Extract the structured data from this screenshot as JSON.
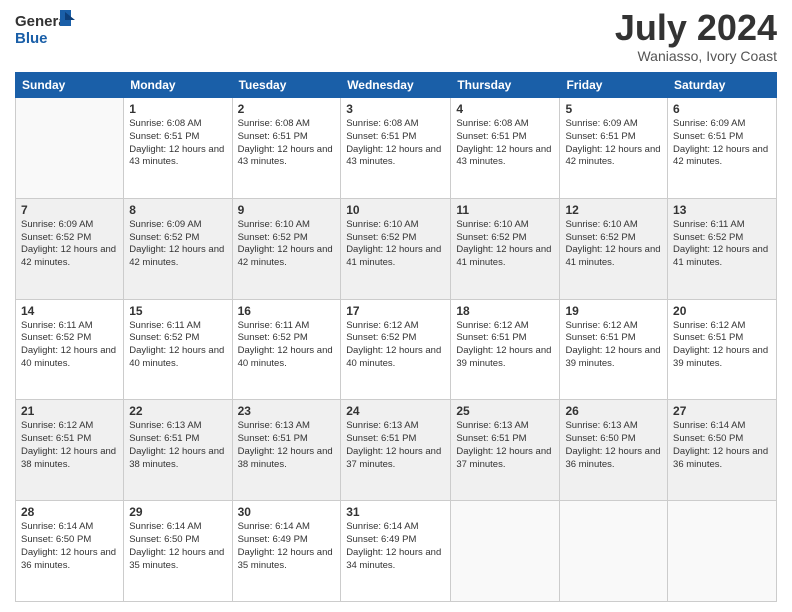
{
  "header": {
    "logo_line1": "General",
    "logo_line2": "Blue",
    "month_title": "July 2024",
    "location": "Waniasso, Ivory Coast"
  },
  "days_of_week": [
    "Sunday",
    "Monday",
    "Tuesday",
    "Wednesday",
    "Thursday",
    "Friday",
    "Saturday"
  ],
  "weeks": [
    [
      {
        "day": "",
        "sunrise": "",
        "sunset": "",
        "daylight": ""
      },
      {
        "day": "1",
        "sunrise": "Sunrise: 6:08 AM",
        "sunset": "Sunset: 6:51 PM",
        "daylight": "Daylight: 12 hours and 43 minutes."
      },
      {
        "day": "2",
        "sunrise": "Sunrise: 6:08 AM",
        "sunset": "Sunset: 6:51 PM",
        "daylight": "Daylight: 12 hours and 43 minutes."
      },
      {
        "day": "3",
        "sunrise": "Sunrise: 6:08 AM",
        "sunset": "Sunset: 6:51 PM",
        "daylight": "Daylight: 12 hours and 43 minutes."
      },
      {
        "day": "4",
        "sunrise": "Sunrise: 6:08 AM",
        "sunset": "Sunset: 6:51 PM",
        "daylight": "Daylight: 12 hours and 43 minutes."
      },
      {
        "day": "5",
        "sunrise": "Sunrise: 6:09 AM",
        "sunset": "Sunset: 6:51 PM",
        "daylight": "Daylight: 12 hours and 42 minutes."
      },
      {
        "day": "6",
        "sunrise": "Sunrise: 6:09 AM",
        "sunset": "Sunset: 6:51 PM",
        "daylight": "Daylight: 12 hours and 42 minutes."
      }
    ],
    [
      {
        "day": "7",
        "sunrise": "Sunrise: 6:09 AM",
        "sunset": "Sunset: 6:52 PM",
        "daylight": "Daylight: 12 hours and 42 minutes."
      },
      {
        "day": "8",
        "sunrise": "Sunrise: 6:09 AM",
        "sunset": "Sunset: 6:52 PM",
        "daylight": "Daylight: 12 hours and 42 minutes."
      },
      {
        "day": "9",
        "sunrise": "Sunrise: 6:10 AM",
        "sunset": "Sunset: 6:52 PM",
        "daylight": "Daylight: 12 hours and 42 minutes."
      },
      {
        "day": "10",
        "sunrise": "Sunrise: 6:10 AM",
        "sunset": "Sunset: 6:52 PM",
        "daylight": "Daylight: 12 hours and 41 minutes."
      },
      {
        "day": "11",
        "sunrise": "Sunrise: 6:10 AM",
        "sunset": "Sunset: 6:52 PM",
        "daylight": "Daylight: 12 hours and 41 minutes."
      },
      {
        "day": "12",
        "sunrise": "Sunrise: 6:10 AM",
        "sunset": "Sunset: 6:52 PM",
        "daylight": "Daylight: 12 hours and 41 minutes."
      },
      {
        "day": "13",
        "sunrise": "Sunrise: 6:11 AM",
        "sunset": "Sunset: 6:52 PM",
        "daylight": "Daylight: 12 hours and 41 minutes."
      }
    ],
    [
      {
        "day": "14",
        "sunrise": "Sunrise: 6:11 AM",
        "sunset": "Sunset: 6:52 PM",
        "daylight": "Daylight: 12 hours and 40 minutes."
      },
      {
        "day": "15",
        "sunrise": "Sunrise: 6:11 AM",
        "sunset": "Sunset: 6:52 PM",
        "daylight": "Daylight: 12 hours and 40 minutes."
      },
      {
        "day": "16",
        "sunrise": "Sunrise: 6:11 AM",
        "sunset": "Sunset: 6:52 PM",
        "daylight": "Daylight: 12 hours and 40 minutes."
      },
      {
        "day": "17",
        "sunrise": "Sunrise: 6:12 AM",
        "sunset": "Sunset: 6:52 PM",
        "daylight": "Daylight: 12 hours and 40 minutes."
      },
      {
        "day": "18",
        "sunrise": "Sunrise: 6:12 AM",
        "sunset": "Sunset: 6:51 PM",
        "daylight": "Daylight: 12 hours and 39 minutes."
      },
      {
        "day": "19",
        "sunrise": "Sunrise: 6:12 AM",
        "sunset": "Sunset: 6:51 PM",
        "daylight": "Daylight: 12 hours and 39 minutes."
      },
      {
        "day": "20",
        "sunrise": "Sunrise: 6:12 AM",
        "sunset": "Sunset: 6:51 PM",
        "daylight": "Daylight: 12 hours and 39 minutes."
      }
    ],
    [
      {
        "day": "21",
        "sunrise": "Sunrise: 6:12 AM",
        "sunset": "Sunset: 6:51 PM",
        "daylight": "Daylight: 12 hours and 38 minutes."
      },
      {
        "day": "22",
        "sunrise": "Sunrise: 6:13 AM",
        "sunset": "Sunset: 6:51 PM",
        "daylight": "Daylight: 12 hours and 38 minutes."
      },
      {
        "day": "23",
        "sunrise": "Sunrise: 6:13 AM",
        "sunset": "Sunset: 6:51 PM",
        "daylight": "Daylight: 12 hours and 38 minutes."
      },
      {
        "day": "24",
        "sunrise": "Sunrise: 6:13 AM",
        "sunset": "Sunset: 6:51 PM",
        "daylight": "Daylight: 12 hours and 37 minutes."
      },
      {
        "day": "25",
        "sunrise": "Sunrise: 6:13 AM",
        "sunset": "Sunset: 6:51 PM",
        "daylight": "Daylight: 12 hours and 37 minutes."
      },
      {
        "day": "26",
        "sunrise": "Sunrise: 6:13 AM",
        "sunset": "Sunset: 6:50 PM",
        "daylight": "Daylight: 12 hours and 36 minutes."
      },
      {
        "day": "27",
        "sunrise": "Sunrise: 6:14 AM",
        "sunset": "Sunset: 6:50 PM",
        "daylight": "Daylight: 12 hours and 36 minutes."
      }
    ],
    [
      {
        "day": "28",
        "sunrise": "Sunrise: 6:14 AM",
        "sunset": "Sunset: 6:50 PM",
        "daylight": "Daylight: 12 hours and 36 minutes."
      },
      {
        "day": "29",
        "sunrise": "Sunrise: 6:14 AM",
        "sunset": "Sunset: 6:50 PM",
        "daylight": "Daylight: 12 hours and 35 minutes."
      },
      {
        "day": "30",
        "sunrise": "Sunrise: 6:14 AM",
        "sunset": "Sunset: 6:49 PM",
        "daylight": "Daylight: 12 hours and 35 minutes."
      },
      {
        "day": "31",
        "sunrise": "Sunrise: 6:14 AM",
        "sunset": "Sunset: 6:49 PM",
        "daylight": "Daylight: 12 hours and 34 minutes."
      },
      {
        "day": "",
        "sunrise": "",
        "sunset": "",
        "daylight": ""
      },
      {
        "day": "",
        "sunrise": "",
        "sunset": "",
        "daylight": ""
      },
      {
        "day": "",
        "sunrise": "",
        "sunset": "",
        "daylight": ""
      }
    ]
  ]
}
